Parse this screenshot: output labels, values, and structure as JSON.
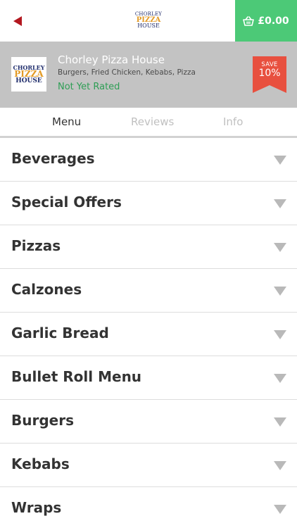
{
  "topbar": {
    "back_icon": "back-arrow-icon",
    "logo": {
      "line1": "CHORLEY",
      "line2": "PIZZA",
      "line3": "HOUSE"
    },
    "basket": {
      "icon": "basket-icon",
      "amount": "£0.00",
      "color": "#4cc977"
    }
  },
  "restaurant": {
    "logo": {
      "line1": "CHORLEY",
      "line2": "PIZZA",
      "line3": "HOUSE"
    },
    "name": "Chorley Pizza House",
    "cuisines": "Burgers, Fried Chicken, Kebabs, Pizza",
    "rating": "Not Yet Rated",
    "badge": {
      "label": "SAVE",
      "value": "10%",
      "color": "#e8503f"
    }
  },
  "tabs": [
    {
      "label": "Menu",
      "active": true
    },
    {
      "label": "Reviews",
      "active": false
    },
    {
      "label": "Info",
      "active": false
    }
  ],
  "categories": [
    {
      "label": "Beverages"
    },
    {
      "label": "Special Offers"
    },
    {
      "label": "Pizzas"
    },
    {
      "label": "Calzones"
    },
    {
      "label": "Garlic Bread"
    },
    {
      "label": "Bullet Roll Menu"
    },
    {
      "label": "Burgers"
    },
    {
      "label": "Kebabs"
    },
    {
      "label": "Wraps"
    }
  ]
}
